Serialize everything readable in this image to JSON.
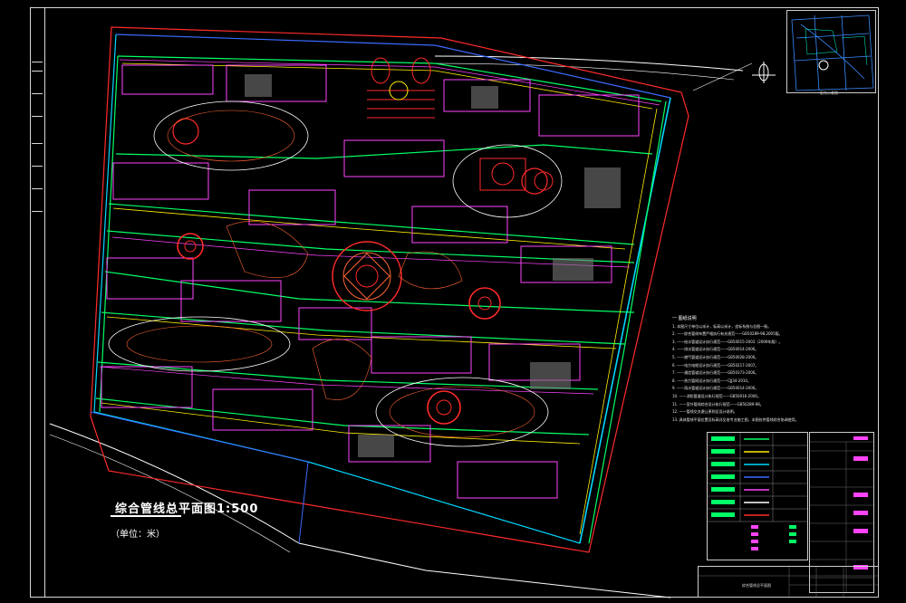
{
  "drawing": {
    "title": "综合管线总平面图1:500",
    "unit_note": "（单位：米）",
    "notes_heading": "一 图纸说明",
    "notes": [
      "1. 本图尺寸单位以米计，标高以米计，坐标系统与总图一致。",
      "2. ——综合管线布置严格执行有关规范——GB50289-98,2005版。",
      "3. ——给水管道设计执行规范——GB50015-2003（2009年版）。",
      "4. ——排水管道设计执行规范——GB50014-2006。",
      "5. ——燃气管道设计执行规范——GB50028-2006。",
      "6. ——电力电缆设计执行规范——GB50217-2007。",
      "7. ——通信管道设计执行规范——GB50373-2006。",
      "8. ——热力管网设计执行规范——CJJ34-2010。",
      "9. ——雨水管道设计执行规范——GB50014-2006。",
      "10. ——消防管道设计执行规范——GB50016-2006。",
      "11. ——室外管线综合设计执行规范——GB50289-98。",
      "12. ——管线交叉避让原则见设计说明。",
      "13. 具体管线平面位置及标高详见各专业施工图，本图仅供管线综合协调使用。"
    ],
    "titleblock_label": "综合管线总平面图",
    "inset_caption": "区位示意图"
  },
  "colors": {
    "boundary": "#ff2a2a",
    "water": "#00ff66",
    "drain": "#00d8ff",
    "gas": "#ffee00",
    "power": "#ff44ff",
    "building": "#ff44ff",
    "road": "#ffffff",
    "landscape": "#ff6633",
    "comm": "#3a6bff"
  }
}
